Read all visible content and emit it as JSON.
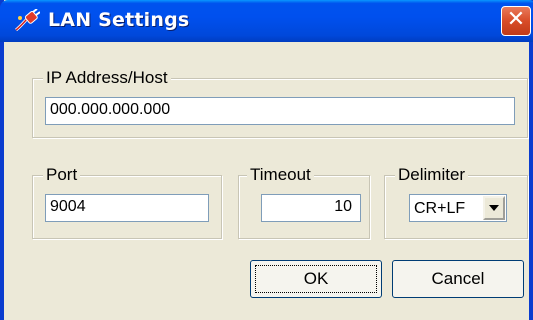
{
  "window": {
    "title": "LAN Settings",
    "close": "✕"
  },
  "ip_group": {
    "legend": "IP Address/Host",
    "value": "000.000.000.000"
  },
  "port_group": {
    "legend": "Port",
    "value": "9004"
  },
  "timeout_group": {
    "legend": "Timeout",
    "value": "10"
  },
  "delimiter_group": {
    "legend": "Delimiter",
    "selected": "CR+LF"
  },
  "buttons": {
    "ok": "OK",
    "cancel": "Cancel"
  }
}
